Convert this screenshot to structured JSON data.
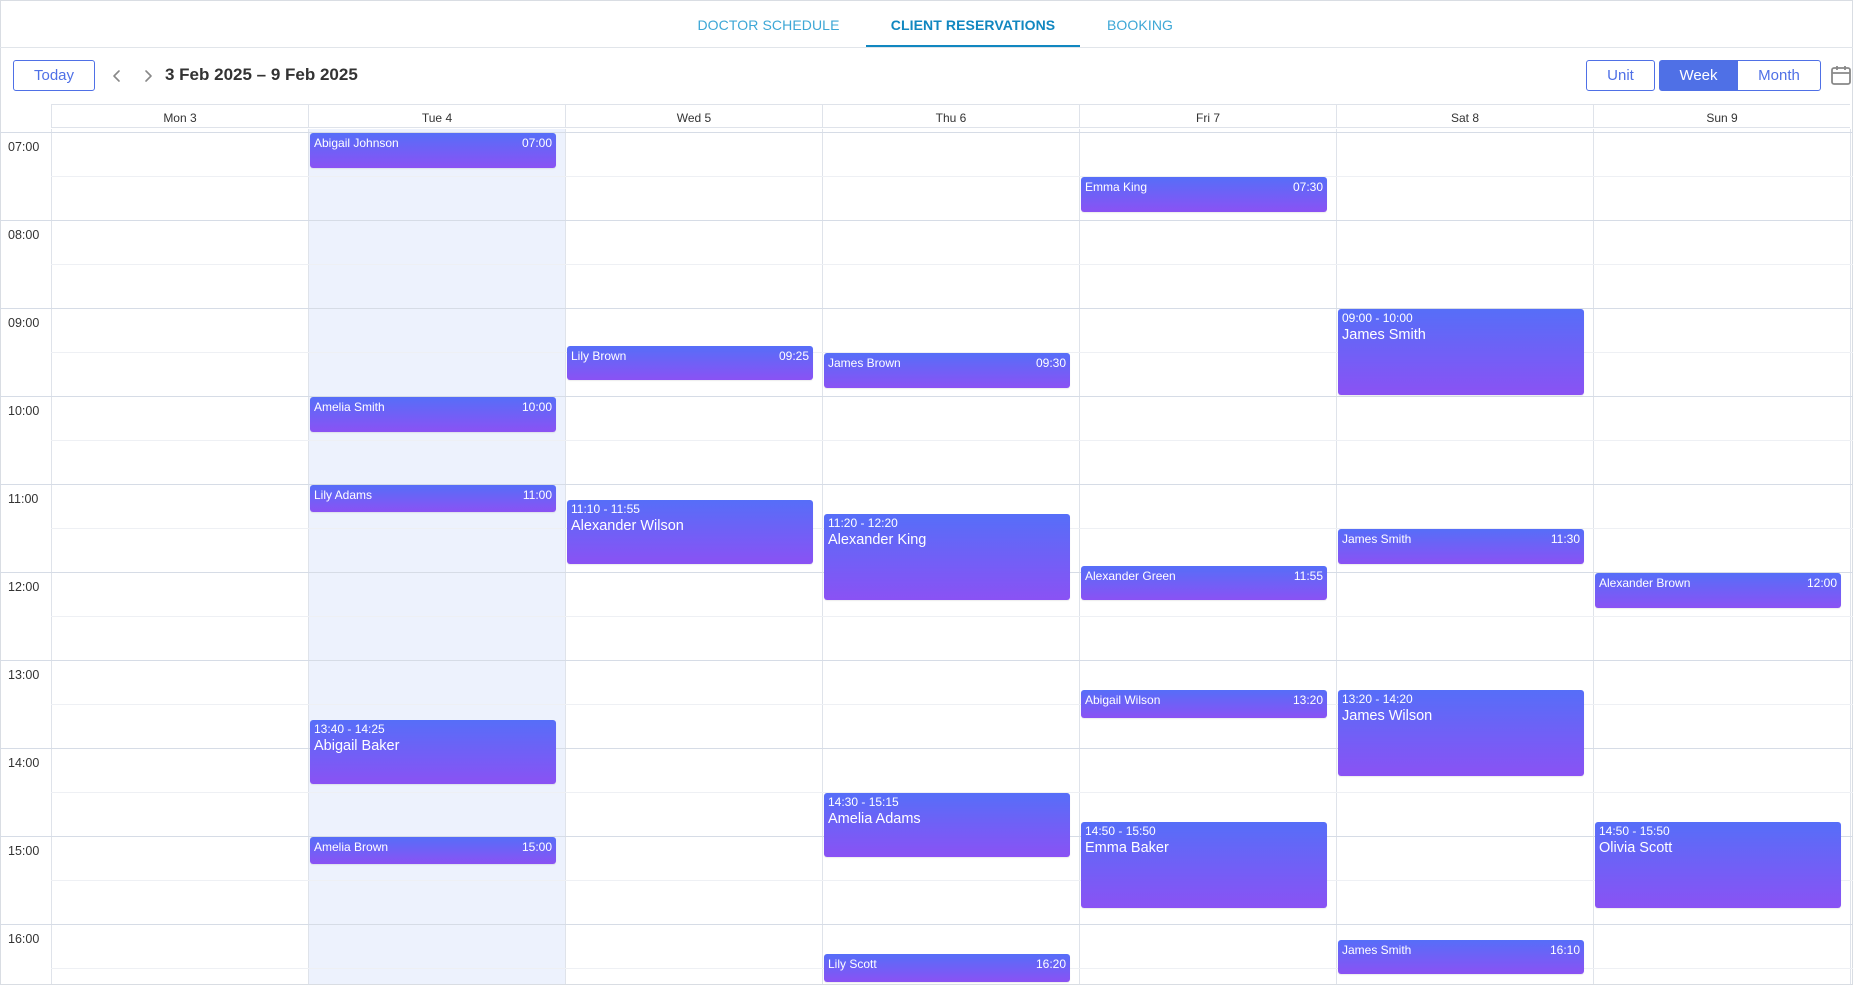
{
  "tabs": [
    {
      "label": "DOCTOR SCHEDULE",
      "active": false
    },
    {
      "label": "CLIENT RESERVATIONS",
      "active": true
    },
    {
      "label": "BOOKING",
      "active": false
    }
  ],
  "toolbar": {
    "today_label": "Today",
    "prev_icon": "chevron-left-icon",
    "next_icon": "chevron-right-icon",
    "date_range": "3 Feb 2025 – 9 Feb 2025",
    "view_modes": [
      {
        "label": "Unit",
        "active": false
      },
      {
        "label": "Week",
        "active": true
      },
      {
        "label": "Month",
        "active": false
      }
    ],
    "calendar_icon": "calendar-icon"
  },
  "calendar": {
    "days": [
      "Mon 3",
      "Tue 4",
      "Wed 5",
      "Thu 6",
      "Fri 7",
      "Sat 8",
      "Sun 9"
    ],
    "today_index": 1,
    "hours": [
      "07:00",
      "08:00",
      "09:00",
      "10:00",
      "11:00",
      "12:00",
      "13:00",
      "14:00",
      "15:00",
      "16:00"
    ],
    "events": [
      {
        "day": 1,
        "start": "07:00",
        "end": "07:25",
        "name": "Abigail Johnson",
        "time": "07:00",
        "style": "compact"
      },
      {
        "day": 4,
        "start": "07:30",
        "end": "07:55",
        "name": "Emma King",
        "time": "07:30",
        "style": "compact"
      },
      {
        "day": 2,
        "start": "09:25",
        "end": "09:50",
        "name": "Lily Brown",
        "time": "09:25",
        "style": "compact"
      },
      {
        "day": 3,
        "start": "09:30",
        "end": "09:55",
        "name": "James Brown",
        "time": "09:30",
        "style": "compact"
      },
      {
        "day": 5,
        "start": "09:00",
        "end": "10:00",
        "name": "James Smith",
        "range": "09:00 - 10:00",
        "style": "tall"
      },
      {
        "day": 1,
        "start": "10:00",
        "end": "10:25",
        "name": "Amelia Smith",
        "time": "10:00",
        "style": "compact"
      },
      {
        "day": 1,
        "start": "11:00",
        "end": "11:20",
        "name": "Lily Adams",
        "time": "11:00",
        "style": "compact"
      },
      {
        "day": 2,
        "start": "11:10",
        "end": "11:55",
        "name": "Alexander Wilson",
        "range": "11:10 - 11:55",
        "style": "tall"
      },
      {
        "day": 3,
        "start": "11:20",
        "end": "12:20",
        "name": "Alexander King",
        "range": "11:20 - 12:20",
        "style": "tall"
      },
      {
        "day": 5,
        "start": "11:30",
        "end": "11:55",
        "name": "James Smith",
        "time": "11:30",
        "style": "compact"
      },
      {
        "day": 4,
        "start": "11:55",
        "end": "12:20",
        "name": "Alexander Green",
        "time": "11:55",
        "style": "compact"
      },
      {
        "day": 6,
        "start": "12:00",
        "end": "12:25",
        "name": "Alexander Brown",
        "time": "12:00",
        "style": "compact"
      },
      {
        "day": 4,
        "start": "13:20",
        "end": "13:40",
        "name": "Abigail Wilson",
        "time": "13:20",
        "style": "compact"
      },
      {
        "day": 5,
        "start": "13:20",
        "end": "14:20",
        "name": "James Wilson",
        "range": "13:20 - 14:20",
        "style": "tall"
      },
      {
        "day": 1,
        "start": "13:40",
        "end": "14:25",
        "name": "Abigail Baker",
        "range": "13:40 - 14:25",
        "style": "tall"
      },
      {
        "day": 3,
        "start": "14:30",
        "end": "15:15",
        "name": "Amelia Adams",
        "range": "14:30 - 15:15",
        "style": "tall"
      },
      {
        "day": 4,
        "start": "14:50",
        "end": "15:50",
        "name": "Emma Baker",
        "range": "14:50 - 15:50",
        "style": "tall"
      },
      {
        "day": 6,
        "start": "14:50",
        "end": "15:50",
        "name": "Olivia Scott",
        "range": "14:50 - 15:50",
        "style": "tall"
      },
      {
        "day": 1,
        "start": "15:00",
        "end": "15:20",
        "name": "Amelia Brown",
        "time": "15:00",
        "style": "compact"
      },
      {
        "day": 5,
        "start": "16:10",
        "end": "16:35",
        "name": "James Smith",
        "time": "16:10",
        "style": "compact"
      },
      {
        "day": 3,
        "start": "16:20",
        "end": "16:40",
        "name": "Lily Scott",
        "time": "16:20",
        "style": "compact"
      }
    ]
  },
  "colors": {
    "accent": "#4f70e6",
    "tab_text": "#3da7d6",
    "tab_active": "#1187c0",
    "event_top": "#566ef8",
    "event_bottom": "#8a52f4",
    "today_column": "#edf2fd"
  }
}
